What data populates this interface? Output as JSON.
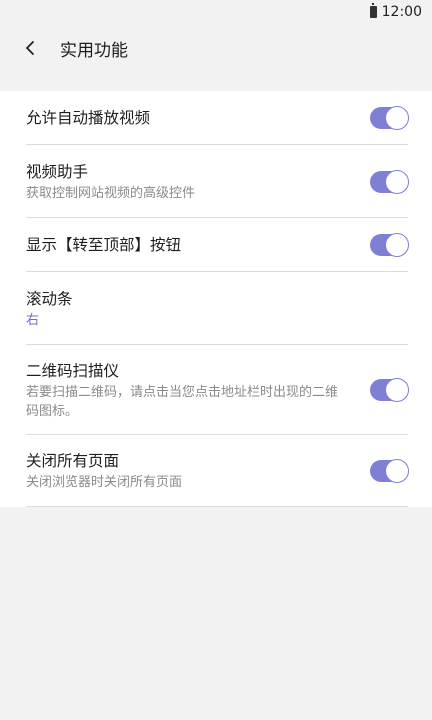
{
  "status_bar": {
    "time": "12:00"
  },
  "header": {
    "title": "实用功能"
  },
  "settings": {
    "autoplay": {
      "title": "允许自动播放视频",
      "enabled": true
    },
    "video_assistant": {
      "title": "视频助手",
      "subtitle": "获取控制网站视频的高级控件",
      "enabled": true
    },
    "back_to_top": {
      "title": "显示【转至顶部】按钮",
      "enabled": true
    },
    "scrollbar": {
      "title": "滚动条",
      "value": "右"
    },
    "qr_scanner": {
      "title": "二维码扫描仪",
      "subtitle": "若要扫描二维码，请点击当您点击地址栏时出现的二维码图标。",
      "enabled": true
    },
    "close_all_pages": {
      "title": "关闭所有页面",
      "subtitle": "关闭浏览器时关闭所有页面",
      "enabled": true
    }
  },
  "colors": {
    "accent": "#7f7fd6",
    "background": "#f2f2f2",
    "list_background": "#ffffff"
  }
}
